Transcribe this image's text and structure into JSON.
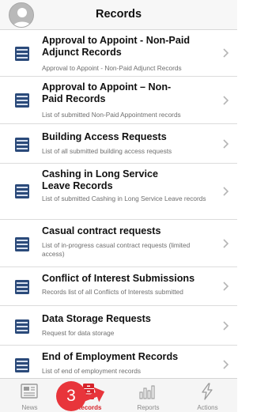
{
  "header": {
    "title": "Records",
    "avatar_icon": "user-avatar-icon"
  },
  "records": [
    {
      "title": "Approval to Appoint - Non-Paid Adjunct Records",
      "subtitle": "Approval to Appoint - Non-Paid Adjunct Records"
    },
    {
      "title": "Approval to Appoint – Non-Paid Records",
      "subtitle": "List of submitted Non-Paid Appointment records"
    },
    {
      "title": "Building Access Requests",
      "subtitle": "List of all submitted building access requests"
    },
    {
      "title": "Cashing in Long Service Leave Records",
      "subtitle": "List of submitted Cashing in Long Service Leave records"
    },
    {
      "title": "Casual contract requests",
      "subtitle": "List of in-progress casual contract requests (limited access)"
    },
    {
      "title": "Conflict of Interest Submissions",
      "subtitle": "Records list of all Conflicts of Interests submitted"
    },
    {
      "title": "Data Storage Requests",
      "subtitle": "Request for data storage"
    },
    {
      "title": "End of Employment Records",
      "subtitle": "List of end of employment records"
    }
  ],
  "tabbar": {
    "tabs": [
      {
        "label": "News",
        "icon": "newspaper-icon",
        "active": false
      },
      {
        "label": "Records",
        "icon": "records-cabinet-icon",
        "active": true
      },
      {
        "label": "Reports",
        "icon": "bar-chart-icon",
        "active": false
      },
      {
        "label": "Actions",
        "icon": "lightning-icon",
        "active": false
      }
    ]
  },
  "annotation": {
    "step_number": "3",
    "accent_color": "#e8353b"
  },
  "colors": {
    "icon_blue": "#2b4a7a",
    "active_red": "#d6242b"
  }
}
